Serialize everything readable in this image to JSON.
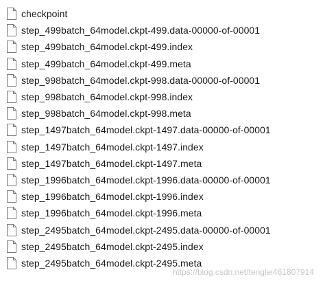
{
  "files": [
    {
      "name": "checkpoint",
      "icon": "file-icon"
    },
    {
      "name": "step_499batch_64model.ckpt-499.data-00000-of-00001",
      "icon": "file-icon"
    },
    {
      "name": "step_499batch_64model.ckpt-499.index",
      "icon": "file-icon"
    },
    {
      "name": "step_499batch_64model.ckpt-499.meta",
      "icon": "file-icon"
    },
    {
      "name": "step_998batch_64model.ckpt-998.data-00000-of-00001",
      "icon": "file-icon"
    },
    {
      "name": "step_998batch_64model.ckpt-998.index",
      "icon": "file-icon"
    },
    {
      "name": "step_998batch_64model.ckpt-998.meta",
      "icon": "file-icon"
    },
    {
      "name": "step_1497batch_64model.ckpt-1497.data-00000-of-00001",
      "icon": "file-icon"
    },
    {
      "name": "step_1497batch_64model.ckpt-1497.index",
      "icon": "file-icon"
    },
    {
      "name": "step_1497batch_64model.ckpt-1497.meta",
      "icon": "file-icon"
    },
    {
      "name": "step_1996batch_64model.ckpt-1996.data-00000-of-00001",
      "icon": "file-icon"
    },
    {
      "name": "step_1996batch_64model.ckpt-1996.index",
      "icon": "file-icon"
    },
    {
      "name": "step_1996batch_64model.ckpt-1996.meta",
      "icon": "file-icon"
    },
    {
      "name": "step_2495batch_64model.ckpt-2495.data-00000-of-00001",
      "icon": "file-icon"
    },
    {
      "name": "step_2495batch_64model.ckpt-2495.index",
      "icon": "file-icon"
    },
    {
      "name": "step_2495batch_64model.ckpt-2495.meta",
      "icon": "file-icon"
    }
  ],
  "watermark": "https://blog.csdn.net/tenglei461807914"
}
